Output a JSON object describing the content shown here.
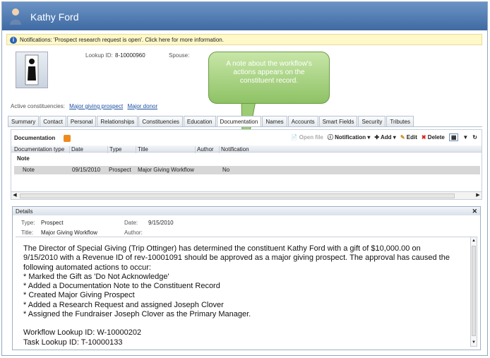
{
  "window": {
    "title": "Kathy Ford"
  },
  "notification": {
    "text": "Notifications: 'Prospect research request is open'.  Click here for more information."
  },
  "header": {
    "lookup_label": "Lookup ID:",
    "lookup_value": "8-10000960",
    "spouse_label": "Spouse:",
    "constituencies_label": "Active constituencies:",
    "constituencies": [
      "Major giving prospect",
      "Major donor"
    ]
  },
  "callout": {
    "text": "A note about the workflow's actions appears on the constituent record."
  },
  "tabs": [
    "Summary",
    "Contact",
    "Personal",
    "Relationships",
    "Constituencies",
    "Education",
    "Documentation",
    "Names",
    "Accounts",
    "Smart Fields",
    "Security",
    "Tributes"
  ],
  "documentation": {
    "title": "Documentation",
    "toolbar": {
      "open_file": "Open file",
      "notification": "Notification",
      "add": "Add",
      "edit": "Edit",
      "delete": "Delete"
    },
    "columns": [
      "Documentation type",
      "Date",
      "Type",
      "Title",
      "Author",
      "Notification"
    ],
    "group": "Note",
    "rows": [
      {
        "doc_type": "Note",
        "date": "09/15/2010",
        "type": "Prospect",
        "title": "Major Giving Workflow",
        "author": "",
        "notification": "No"
      }
    ]
  },
  "details": {
    "title": "Details",
    "type_label": "Type:",
    "type_value": "Prospect",
    "date_label": "Date:",
    "date_value": "9/15/2010",
    "title_label": "Title:",
    "title_value": "Major Giving Workflow",
    "author_label": "Author:",
    "body": [
      "The Director of Special Giving (Trip Ottinger) has determined the constituent Kathy Ford with a gift of $10,000.00 on",
      "9/15/2010 with a Revenue ID of rev-10001091 should be approved as a major giving prospect. The approval has caused the",
      "following automated actions to occur:",
      "* Marked the Gift as 'Do Not Acknowledge'",
      "* Added a Documentation Note to the Constituent Record",
      "* Created Major Giving Prospect",
      "* Added a Research Request and assigned Joseph Clover",
      "* Assigned the Fundraiser Joseph Clover as the Primary Manager.",
      "",
      "Workflow Lookup ID: W-10000202",
      "Task Lookup ID: T-10000133"
    ]
  },
  "colors": {
    "title_bar": "#4f79b1",
    "callout": "#9ccc74",
    "notification_bg": "#fff8c8",
    "link": "#1a4fa0"
  }
}
